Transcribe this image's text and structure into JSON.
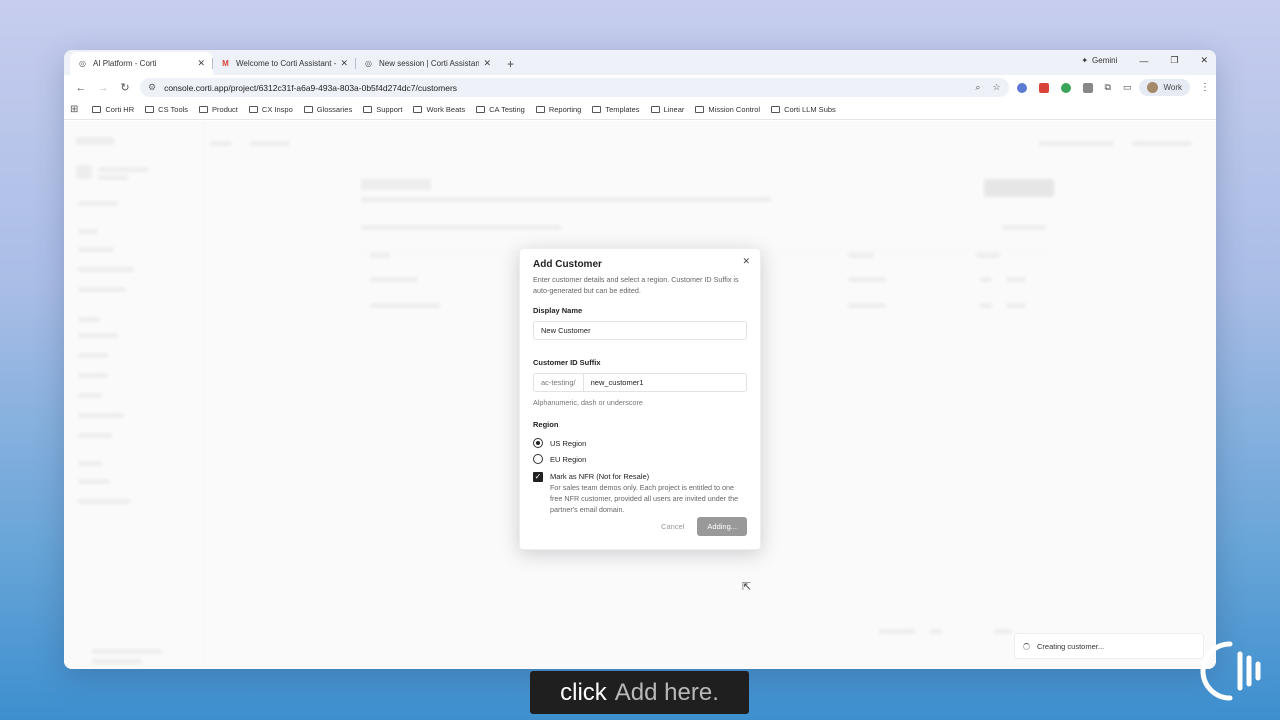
{
  "tabs": [
    {
      "label": "AI Platform - Corti",
      "icon": "corti-icon",
      "active": true
    },
    {
      "label": "Welcome to Corti Assistant - a",
      "icon": "gmail-icon",
      "active": false
    },
    {
      "label": "New session | Corti Assistant",
      "icon": "corti-icon",
      "active": false
    }
  ],
  "browser": {
    "gemini_label": "Gemini",
    "url": "console.corti.app/project/6312c31f-a6a9-493a-803a-0b5f4d274dc7/customers",
    "profile_label": "Work"
  },
  "bookmarks": [
    "Corti HR",
    "CS Tools",
    "Product",
    "CX Inspo",
    "Glossaries",
    "Support",
    "Work Beats",
    "CA Testing",
    "Reporting",
    "Templates",
    "Linear",
    "Mission Control",
    "Corti LLM Subs"
  ],
  "dialog": {
    "title": "Add Customer",
    "description": "Enter customer details and select a region. Customer ID Suffix is auto-generated but can be edited.",
    "display_name_label": "Display Name",
    "display_name_value": "New Customer",
    "suffix_label": "Customer ID Suffix",
    "suffix_prefix": "ac-testing/",
    "suffix_value": "new_customer1",
    "suffix_hint": "Alphanumeric, dash or underscore",
    "region_label": "Region",
    "region_us": "US Region",
    "region_eu": "EU Region",
    "nfr_label": "Mark as NFR (Not for Resale)",
    "nfr_description": "For sales team demos only. Each project is entitled to one free NFR customer, provided all users are invited under the partner's email domain.",
    "cancel_label": "Cancel",
    "submit_label": "Adding..."
  },
  "toast": {
    "text": "Creating customer..."
  },
  "caption": {
    "prefix": "click",
    "highlight": "Add here."
  }
}
